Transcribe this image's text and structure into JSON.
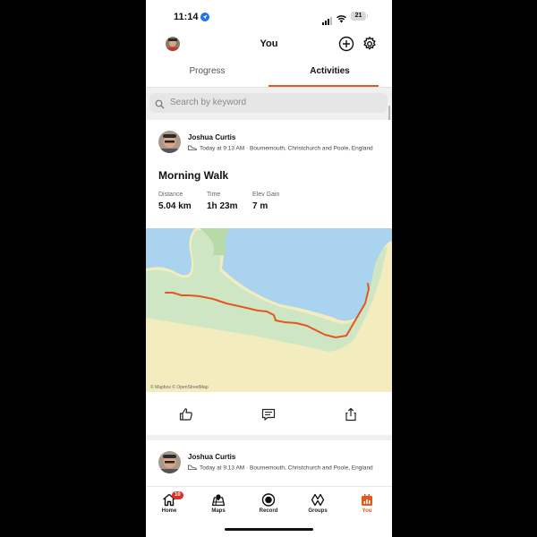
{
  "status_bar": {
    "time": "11:14",
    "battery": "21"
  },
  "header": {
    "title": "You"
  },
  "tabs": [
    {
      "label": "Progress",
      "active": false
    },
    {
      "label": "Activities",
      "active": true
    }
  ],
  "search": {
    "placeholder": "Search by keyword"
  },
  "activities": [
    {
      "athlete": "Joshua Curtis",
      "meta": "Today at 9:13 AM · Bournemouth, Christchurch and Poole, England",
      "title": "Morning Walk",
      "stats": [
        {
          "label": "Distance",
          "value": "5.04 km"
        },
        {
          "label": "Time",
          "value": "1h 23m"
        },
        {
          "label": "Elev Gain",
          "value": "7 m"
        }
      ],
      "map_attribution": "© Mapbox © OpenStreetMap"
    },
    {
      "athlete": "Joshua Curtis",
      "meta": "Today at 9:13 AM · Bournemouth, Christchurch and Poole, England"
    }
  ],
  "tabbar": [
    {
      "label": "Home",
      "icon": "home-icon",
      "badge": "10"
    },
    {
      "label": "Maps",
      "icon": "maps-icon"
    },
    {
      "label": "Record",
      "icon": "record-icon"
    },
    {
      "label": "Groups",
      "icon": "groups-icon"
    },
    {
      "label": "You",
      "icon": "you-icon",
      "active": true
    }
  ],
  "colors": {
    "accent": "#e2581f",
    "route": "#e2581f",
    "water": "#a9d3ef",
    "land": "#cfe6c4",
    "beach": "#f3ecbf"
  }
}
